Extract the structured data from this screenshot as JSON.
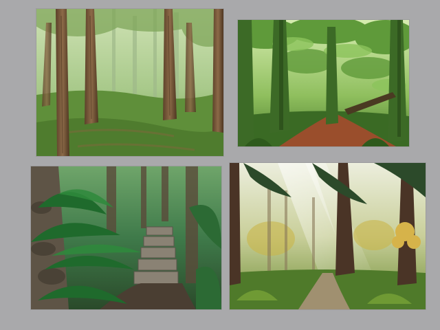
{
  "page": {
    "background": "#a9a9ab"
  },
  "paintings": [
    {
      "subject": "misty-forest-clearing-painting",
      "palette": [
        "#b7d49a",
        "#6f9a48",
        "#7a5a3c",
        "#4f7c34"
      ]
    },
    {
      "subject": "mossy-forest-path-painting",
      "palette": [
        "#cfe7a8",
        "#3f7a2a",
        "#8e4a2a",
        "#2d4f1f"
      ]
    },
    {
      "subject": "fern-stone-steps-painting",
      "palette": [
        "#3f7a4a",
        "#1f5a2c",
        "#7a7468",
        "#4a3e32"
      ]
    },
    {
      "subject": "sunlit-forest-trail-painting",
      "palette": [
        "#e6e6c6",
        "#8fa93c",
        "#5a4030",
        "#d6b34a"
      ]
    }
  ]
}
